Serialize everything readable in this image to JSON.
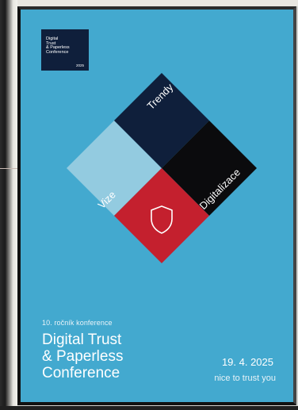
{
  "logo": {
    "text": "Digital\nTrust\n& Paperless\nConference",
    "year": "2025"
  },
  "diamonds": {
    "top_label": "Trendy",
    "left_label": "Vize",
    "right_label": "Digitalizace",
    "bottom_icon": "shield-icon",
    "colors": {
      "background": "#43a9cf",
      "top": "#0f1f3b",
      "left": "#93cbe0",
      "right": "#0b0b0d",
      "bottom": "#c4202e"
    }
  },
  "subtitle": "10. ročník konference",
  "title": "Digital Trust\n& Paperless\nConference",
  "date": "19. 4. 2025",
  "tagline": "nice to trust you"
}
